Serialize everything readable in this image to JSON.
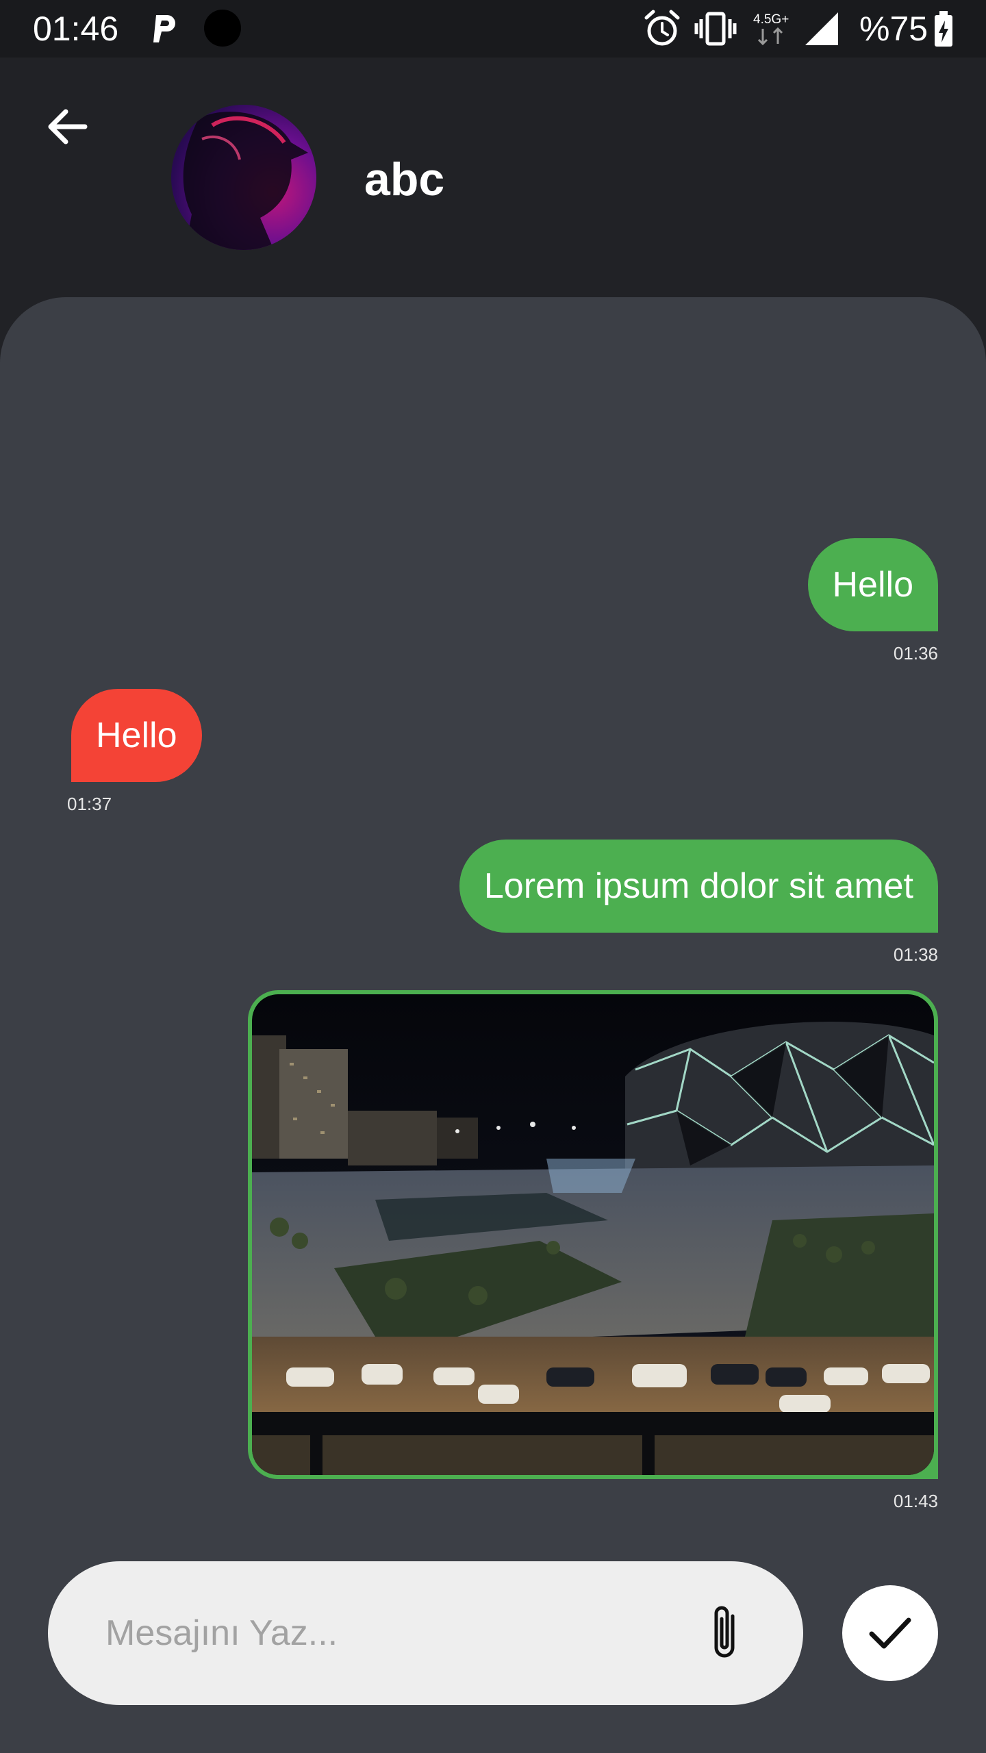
{
  "status_bar": {
    "time": "01:46",
    "network": "4.5G+",
    "battery": "%75",
    "icons": [
      "p-icon",
      "camera-dot-icon",
      "alarm-icon",
      "vibrate-icon",
      "network-45g-icon",
      "signal-icon",
      "battery-charging-icon"
    ]
  },
  "header": {
    "contact_name": "abc",
    "icons": [
      "back-arrow-icon",
      "avatar"
    ]
  },
  "messages": [
    {
      "direction": "outgoing",
      "text": "Hello",
      "time": "01:36"
    },
    {
      "direction": "incoming",
      "text": "Hello",
      "time": "01:37"
    },
    {
      "direction": "outgoing",
      "text": "Lorem ipsum dolor sit amet",
      "time": "01:38"
    },
    {
      "direction": "outgoing",
      "type": "image",
      "time": "01:43"
    }
  ],
  "composer": {
    "placeholder": "Mesajını Yaz...",
    "value": "",
    "icons": [
      "paperclip-icon",
      "checkmark-icon"
    ]
  },
  "colors": {
    "background": "#212226",
    "panel": "#3c3f46",
    "outgoing_bubble": "#4caf50",
    "incoming_bubble": "#f44336",
    "composer": "#eeeeee"
  }
}
